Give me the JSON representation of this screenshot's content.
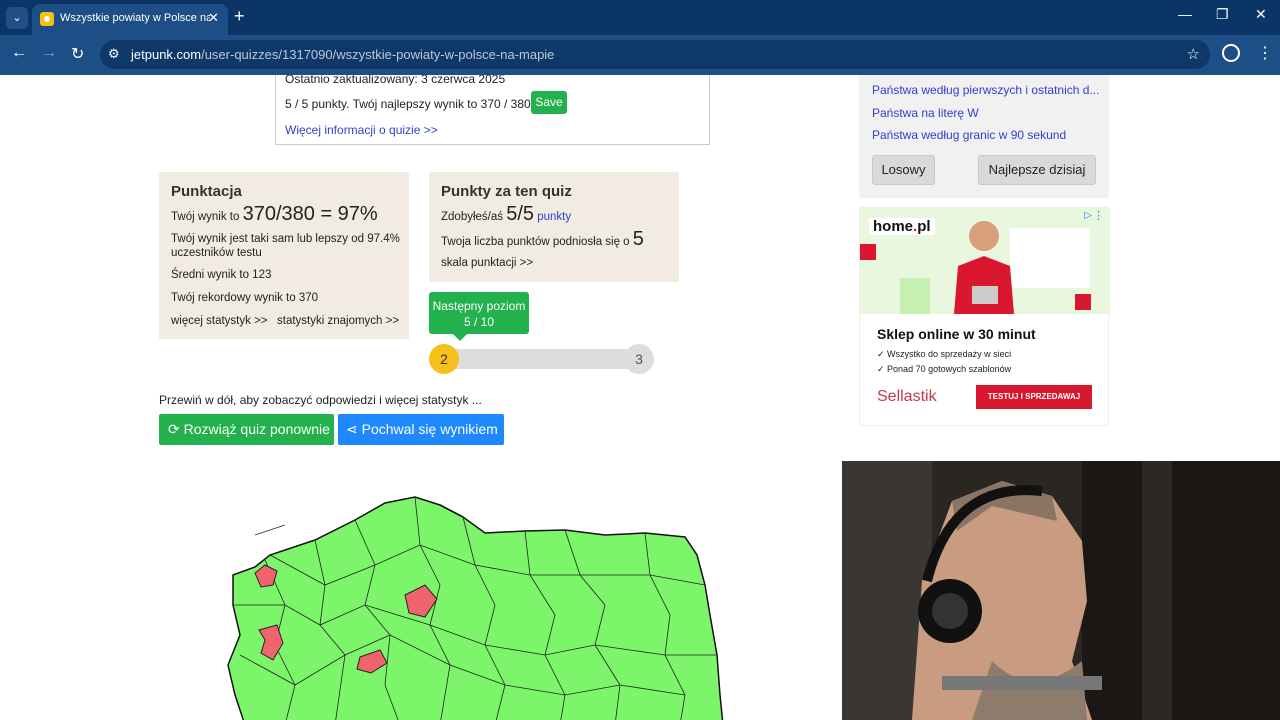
{
  "browser": {
    "tab_title": "Wszystkie powiaty w Polsce na",
    "url_host": "jetpunk.com",
    "url_path": "/user-quizzes/1317090/wszystkie-powiaty-w-polsce-na-mapie"
  },
  "quiz_info": {
    "updated": "Ostatnio zaktualizowany: 3 czerwca 2025",
    "score_text": "5 / 5 punkty. Twój najlepszy wynik to 370 / 380.",
    "save_label": "Save",
    "more_info": "Więcej informacji o quizie >>"
  },
  "scoring": {
    "title": "Punktacja",
    "your_score_prefix": "Twój wynik to",
    "your_score_value": "370/380 = 97%",
    "percentile_line1": "Twój wynik jest taki sam lub lepszy od 97.4%",
    "percentile_line2": "uczestników testu",
    "average": "Średni wynik to 123",
    "record": "Twój rekordowy wynik to 370",
    "more_stats": "więcej statystyk >>",
    "friends_stats": "statystyki znajomych >>"
  },
  "points": {
    "title": "Punkty za ten quiz",
    "earned_prefix": "Zdobyłeś/aś",
    "earned_value": "5/5",
    "earned_link": "punkty",
    "raised_prefix": "Twoja liczba punktów podniosła się o",
    "raised_value": "5",
    "scale_link": "skala punktacji >>"
  },
  "level": {
    "next_label": "Następny poziom",
    "progress_text": "5 / 10",
    "progress_fraction": 0.5,
    "current": "2",
    "next": "3"
  },
  "actions": {
    "hint": "Przewiń w dół, aby zobaczyć odpowiedzi i więcej statystyk ...",
    "retry": "Rozwiąż quiz ponownie",
    "share": "Pochwal się wynikiem"
  },
  "sidebar": {
    "links": [
      "Państwa według pierwszych i ostatnich d...",
      "Państwa na literę W",
      "Państwa według granic w 90 sekund"
    ],
    "random_label": "Losowy",
    "best_today_label": "Najlepsze dzisiaj"
  },
  "ad": {
    "logo_pre": "home",
    "logo_dot": ".",
    "logo_post": "pl",
    "headline": "Sklep online w 30 minut",
    "bullet1": "Wszystko do sprzedaży w sieci",
    "bullet2": "Ponad 70 gotowych szablonów",
    "brand": "Sellastik",
    "cta": "TESTUJ I SPRZEDAWAJ"
  },
  "colors": {
    "map_correct": "#7cf56a",
    "map_missed": "#f0646e",
    "green": "#22b14c",
    "blue": "#1e88ff"
  }
}
